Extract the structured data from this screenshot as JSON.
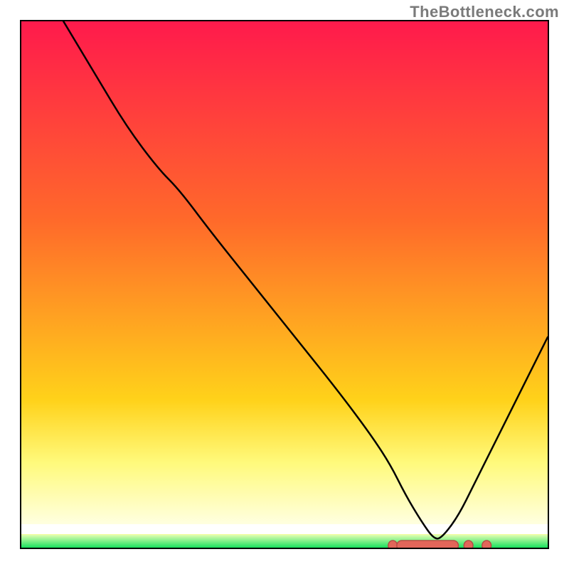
{
  "watermark": "TheBottleneck.com",
  "colors": {
    "gradient_top": "#ff1a4c",
    "gradient_mid1": "#ff6a2a",
    "gradient_mid2": "#ffd21a",
    "gradient_yellow_light": "#fffa7d",
    "white_band": "#ffffff",
    "green_top": "#e6ffb3",
    "green_bottom": "#18e05e",
    "curve": "#000000",
    "marker_fill": "#e2665a",
    "marker_stroke": "#b24c43"
  },
  "layout": {
    "plot_inner_w": 740,
    "plot_inner_h": 740,
    "yellow_light_band_top_frac": 0.84,
    "white_band_top_frac": 0.955,
    "white_band_bottom_frac": 0.975,
    "green_band_top_frac": 0.975
  },
  "chart_data": {
    "type": "line",
    "title": "",
    "xlabel": "",
    "ylabel": "",
    "xlim": [
      0,
      100
    ],
    "ylim": [
      0,
      100
    ],
    "grid": false,
    "legend": false,
    "series": [
      {
        "name": "bottleneck-curve",
        "x": [
          8,
          14,
          20,
          26,
          30,
          36,
          44,
          52,
          60,
          66,
          70,
          73,
          76,
          78.5,
          80,
          83,
          86,
          90,
          94,
          98,
          100
        ],
        "y": [
          100,
          90,
          80,
          72,
          68,
          60,
          50,
          40,
          30,
          22,
          16,
          10,
          5,
          1.5,
          2,
          6,
          12,
          20,
          28,
          36,
          40
        ]
      }
    ],
    "annotations": [
      {
        "type": "marker-cluster",
        "name": "optimal-range",
        "x_start": 70,
        "x_end": 85,
        "y": 1.5
      }
    ]
  }
}
